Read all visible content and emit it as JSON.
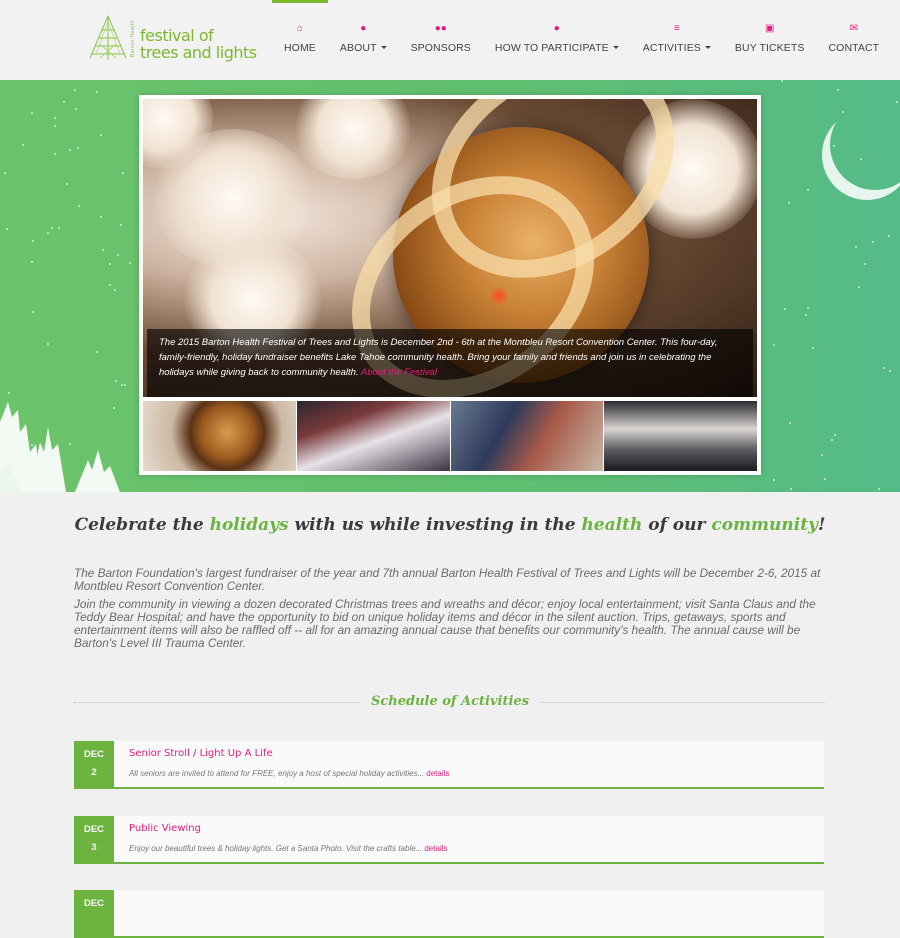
{
  "logo": {
    "vertical_text": "Barton Health",
    "line1": "festival of",
    "line2": "trees and lights"
  },
  "nav": [
    {
      "label": "HOME",
      "icon": "home-icon",
      "active": true
    },
    {
      "label": "ABOUT",
      "icon": "user-icon",
      "dropdown": true
    },
    {
      "label": "SPONSORS",
      "icon": "users-icon"
    },
    {
      "label": "HOW TO PARTICIPATE",
      "icon": "comments-icon",
      "dropdown": true
    },
    {
      "label": "ACTIVITIES",
      "icon": "list-icon",
      "dropdown": true
    },
    {
      "label": "BUY TICKETS",
      "icon": "ticket-icon"
    },
    {
      "label": "CONTACT",
      "icon": "envelope-icon"
    }
  ],
  "hero": {
    "caption": "The 2015 Barton Health Festival of Trees and Lights is December 2nd - 6th at the Montbleu Resort Convention Center. This four-day, family-friendly, holiday fundraiser benefits Lake Tahoe community health. Bring your family and friends and join us in celebrating the holidays while giving back to community health.",
    "caption_link": "About the Festival"
  },
  "headline": {
    "p1": "Celebrate the ",
    "w1": "holidays",
    "p2": " with us while investing in the ",
    "w2": "health",
    "p3": " of our ",
    "w3": "community",
    "p4": "!"
  },
  "intro": {
    "p1": "The Barton Foundation's largest fundraiser of the year and 7th annual Barton Health Festival of Trees and Lights will be December 2-6, 2015 at Montbleu Resort Convention Center.",
    "p2": "Join the community in viewing a dozen decorated Christmas trees and wreaths and décor; enjoy local entertainment; visit Santa Claus and the Teddy Bear Hospital; and have the opportunity to bid on unique holiday items and décor in the silent auction. Trips, getaways, sports and entertainment items will also be raffled off -- all for an amazing annual cause that benefits our community's health. The annual cause will be Barton's Level III Trauma Center."
  },
  "schedule": {
    "title": "Schedule of Activities",
    "events": [
      {
        "month": "DEC",
        "day": "2",
        "title": "Senior Stroll / Light Up A Life",
        "desc": "All seniors are invited to attend for FREE, enjoy a host of special holiday activities...",
        "link": "details"
      },
      {
        "month": "DEC",
        "day": "3",
        "title": "Public Viewing",
        "desc": "Enjoy our beautiful trees & holiday lights. Get a Santa Photo. Visit the crafts table...",
        "link": "details"
      },
      {
        "month": "DEC",
        "day": "",
        "title": "",
        "desc": "",
        "link": ""
      }
    ]
  },
  "colors": {
    "brand_green": "#6cb33f",
    "brand_pink": "#e8197d"
  }
}
